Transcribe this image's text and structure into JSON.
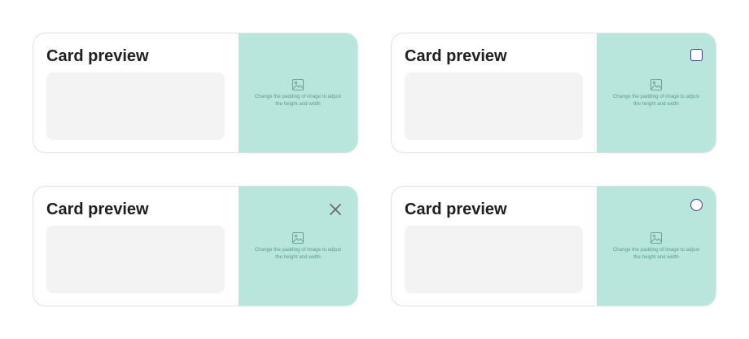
{
  "cards": [
    {
      "title": "Card preview",
      "media_caption": "Change the padding of image to adjust the height and width",
      "media_icon": "image-icon",
      "control": "none"
    },
    {
      "title": "Card preview",
      "media_caption": "Change the padding of image to adjust the height and width",
      "media_icon": "image-icon",
      "control": "checkbox",
      "checked": false
    },
    {
      "title": "Card preview",
      "media_caption": "Change the padding of image to adjust the height and width",
      "media_icon": "image-icon",
      "control": "close",
      "control_icon": "close-icon"
    },
    {
      "title": "Card preview",
      "media_caption": "Change the padding of image to adjust the height and width",
      "media_icon": "image-icon",
      "control": "radio",
      "checked": false
    }
  ],
  "colors": {
    "media_background": "#b9e6dc",
    "body_placeholder": "#f3f3f3",
    "card_border": "#e0e0e0",
    "control_border": "#3b3f7a",
    "close_icon": "#6b6b6b",
    "caption_text": "#5c9c8c"
  }
}
